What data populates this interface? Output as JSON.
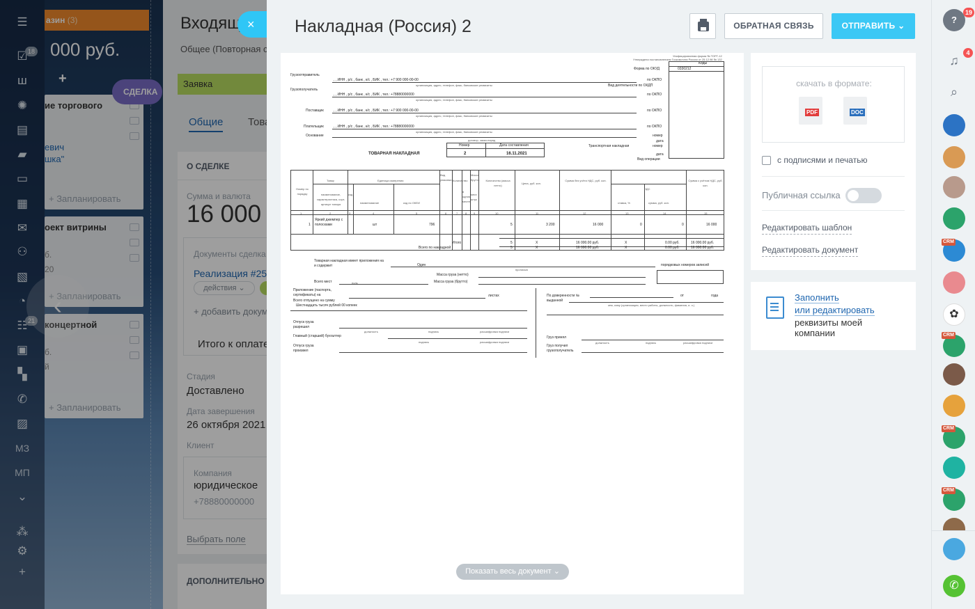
{
  "backdrop": {
    "nav_badges": {
      "tasks": "18",
      "feed": "21"
    },
    "nav_labels": {
      "mz": "МЗ",
      "mp": "МП"
    },
    "column_title": "азин",
    "column_count": "(3)",
    "column_sum": "000 руб.",
    "add_symbol": "+",
    "cards": [
      {
        "title": "ие торгового",
        "line1": "евич",
        "line2": "шка\"",
        "plan": "+ Запланировать"
      },
      {
        "title": "оект витрины",
        "line1": "б.",
        "line2": "20",
        "plan": "+ Запланировать"
      },
      {
        "title": "концертной",
        "line1": "б.",
        "line2": "й",
        "plan": "+ Запланировать"
      }
    ],
    "deal_pill": "СДЕЛКА"
  },
  "deal": {
    "title": "Входящ",
    "subtitle": "Общее (Повторная с",
    "stage": "Заявка",
    "tab_general": "Общие",
    "tab_goods": "Това",
    "about_header": "О СДЕЛКЕ",
    "sum_caption": "Сумма и валюта",
    "sum_value": "16 000",
    "docs_caption": "Документы сделка",
    "doc_link": "Реализация #25/",
    "actions_label": "действия",
    "add_doc": "+ добавить докуме",
    "total_label": "Итого к оплате",
    "stage_caption": "Стадия",
    "stage_value": "Доставлено",
    "close_caption": "Дата завершения",
    "close_value": "26 октября 2021",
    "client_caption": "Клиент",
    "company_caption": "Компания",
    "company_value": "юридическое",
    "company_phone": "+78880000000",
    "choose_field": "Выбрать поле",
    "extra_header": "ДОПОЛНИТЕЛЬНО"
  },
  "slider": {
    "close_symbol": "×",
    "title": "Накладная (Россия) 2",
    "feedback_label": "ОБРАТНАЯ СВЯЗЬ",
    "send_label": "ОТПРАВИТЬ",
    "show_all_label": "Показать весь документ",
    "download_caption": "скачать в формате:",
    "pdf_label": "PDF",
    "doc_label": "DOC",
    "stamps_label": "с подписями и печатью",
    "public_link_label": "Публичная ссылка",
    "edit_template": "Редактировать шаблон",
    "edit_document": "Редактировать документ",
    "fill_link_1": "Заполнить",
    "fill_link_2": "или редактировать",
    "fill_text": "реквизиты моей компании"
  },
  "invoice": {
    "approval": "Унифицированная форма № ТОРГ-12\nУтверждена постановлением Госкомстата России от 25.12.98 № 132",
    "codes_label": "Коды",
    "okud_label": "Форма по ОКУД",
    "okud_value": "0330212",
    "okpo": "по ОКПО",
    "okdp": "Вид деятельности по ОКДП",
    "shipper_label": "Грузоотправитель",
    "receiver_label": "Грузополучатель",
    "supplier_label": "Поставщик",
    "payer_label": "Плательщик",
    "basis_label": "Основание",
    "shipper_value": ", , ИНН , р/с , банк , к/с , БИК , тел.: +7 900 000-00-00",
    "receiver_value": ", , ИНН , р/с , банк , к/с , БИК , тел.: +78880000000",
    "org_hint": "организация, адрес, телефон, факс, банковские реквизиты",
    "basis_hint": "договор, заказ-наряд",
    "number_label": "Номер",
    "date_label": "Дата составления",
    "doc_title": "ТОВАРНАЯ НАКЛАДНАЯ",
    "doc_number": "2",
    "doc_date": "16.11.2021",
    "transport_label": "Транспортная накладная",
    "nomer": "номер",
    "data": "дата",
    "op_type": "Вид операции",
    "col_headers": [
      "Номер по порядку",
      "Товар",
      "Единица измерения",
      "Вид упаковки",
      "Количество",
      "Масса брутто",
      "Количество (масса нетто)",
      "Цена, руб. коп.",
      "Сумма без учёта НДС, руб. коп.",
      "НДС",
      "Сумма с учётом НДС, руб. коп."
    ],
    "sub_headers": [
      "наименование, характеристика, сорт, артикул товара",
      "код",
      "наименование",
      "код по ОКЕИ",
      "в одном месте",
      "мест, штук",
      "ставка, %",
      "сумма, руб. коп."
    ],
    "col_nums": [
      "1",
      "2",
      "3",
      "4",
      "5",
      "6",
      "7",
      "8",
      "9",
      "10",
      "11",
      "12",
      "13",
      "14",
      "15"
    ],
    "row": {
      "n": "1",
      "name": "Яркий джемпер с полосками",
      "unit": "шт",
      "okei": "796",
      "qty": "5",
      "price": "3 200",
      "sum": "16 000",
      "vat_rate": "0",
      "vat_sum": "0",
      "total": "16 000"
    },
    "itogo": {
      "label": "Итого",
      "qty": "5",
      "price": "X",
      "sum": "16 000.00 руб.",
      "rate": "X",
      "vat": "0.00 руб.",
      "total": "16 000.00 руб."
    },
    "vsego": {
      "label": "Всего по накладной",
      "qty": "5",
      "price": "X",
      "sum": "16 000.00 руб.",
      "rate": "X",
      "vat": "0.00 руб.",
      "total": "16 000.00 руб."
    },
    "appendix": "Товарная накладная имеет приложения на и содержит",
    "one": "Один",
    "order_records": "порядковых номеров записей",
    "propis": "прописью",
    "mass_net": "Масса груза (нетто)",
    "mass_gross": "Масса груза (брутто)",
    "total_places": "Всего мест",
    "zero": "ноль",
    "attach": "Приложение (паспорта, сертификаты) на",
    "sheets": "листах",
    "released_sum": "Всего отпущено на сумму",
    "sum_words": "Шестнадцать тысяч рублей 00 копеек",
    "release_allowed": "Отпуск груза разрешил",
    "chief_acc": "Главный (старший) бухгалтер",
    "released_by": "Отпуск груза произвел",
    "position": "должность",
    "signature": "подпись",
    "decipher": "расшифровка подписи",
    "power_of_attorney": "По доверенности №",
    "issued": "выданной",
    "ot": "от",
    "year": "года",
    "issued_hint": "кем, кому (организация, место работы, должность, фамилия, и. о.)",
    "cargo_accepted": "Груз принял",
    "cargo_received": "Груз получил грузополучатель"
  },
  "right_bar": {
    "help_badge": "19",
    "bell_badge": "4",
    "crm_tag": "CRM"
  }
}
